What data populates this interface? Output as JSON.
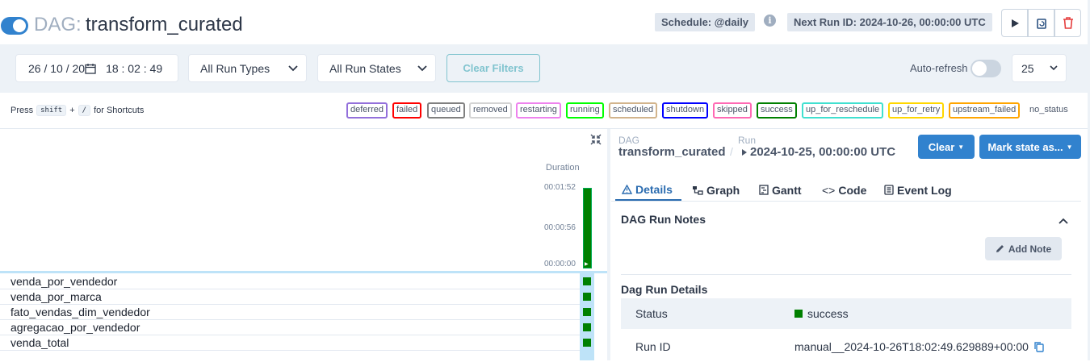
{
  "header": {
    "dag_prefix": "DAG:",
    "dag_id": "transform_curated",
    "schedule": "Schedule: @daily",
    "info_icon": "i",
    "next_run": "Next Run ID: 2024-10-26, 00:00:00 UTC",
    "paused": false
  },
  "filters": {
    "date_value": "26 / 10 / 20",
    "time_value": "18 : 02 : 49",
    "run_type": "All Run Types",
    "run_state": "All Run States",
    "clear_label": "Clear Filters",
    "auto_refresh_label": "Auto-refresh",
    "auto_refresh_on": false,
    "page_size": "25"
  },
  "shortcuts": {
    "press": "Press",
    "key1": "shift",
    "plus": "+",
    "key2": "/",
    "suffix": "for Shortcuts"
  },
  "legend": [
    {
      "label": "deferred",
      "color": "#9370db"
    },
    {
      "label": "failed",
      "color": "#ff0000"
    },
    {
      "label": "queued",
      "color": "#808080"
    },
    {
      "label": "removed",
      "color": "#d3d3d3"
    },
    {
      "label": "restarting",
      "color": "#ee82ee"
    },
    {
      "label": "running",
      "color": "#00ff00"
    },
    {
      "label": "scheduled",
      "color": "#d2b48c"
    },
    {
      "label": "shutdown",
      "color": "#0000ff"
    },
    {
      "label": "skipped",
      "color": "#ff69b4"
    },
    {
      "label": "success",
      "color": "#008000"
    },
    {
      "label": "up_for_reschedule",
      "color": "#40e0d0"
    },
    {
      "label": "up_for_retry",
      "color": "#ffd700"
    },
    {
      "label": "upstream_failed",
      "color": "#ffa500"
    },
    {
      "label": "no_status",
      "color": "transparent"
    }
  ],
  "grid": {
    "duration_label": "Duration",
    "ticks": [
      "00:01:52",
      "00:00:56",
      "00:00:00"
    ],
    "run_duration_fraction": 1.0,
    "tasks": [
      "venda_por_vendedor",
      "venda_por_marca",
      "fato_vendas_dim_vendedor",
      "agregacao_por_vendedor",
      "venda_total"
    ]
  },
  "panel": {
    "dag_label": "DAG",
    "dag_id": "transform_curated",
    "separator": "/",
    "run_label": "Run",
    "run_value": "2024-10-25, 00:00:00 UTC",
    "clear_btn": "Clear",
    "mark_btn": "Mark state as...",
    "tabs": [
      "Details",
      "Graph",
      "Gantt",
      "Code",
      "Event Log"
    ],
    "notes_title": "DAG Run Notes",
    "add_note": "Add Note",
    "details_title": "Dag Run Details",
    "status_key": "Status",
    "status_value": "success",
    "runid_key": "Run ID",
    "runid_value": "manual__2024-10-26T18:02:49.629889+00:00"
  },
  "colors": {
    "accent": "#3182ce",
    "success": "#008000"
  }
}
